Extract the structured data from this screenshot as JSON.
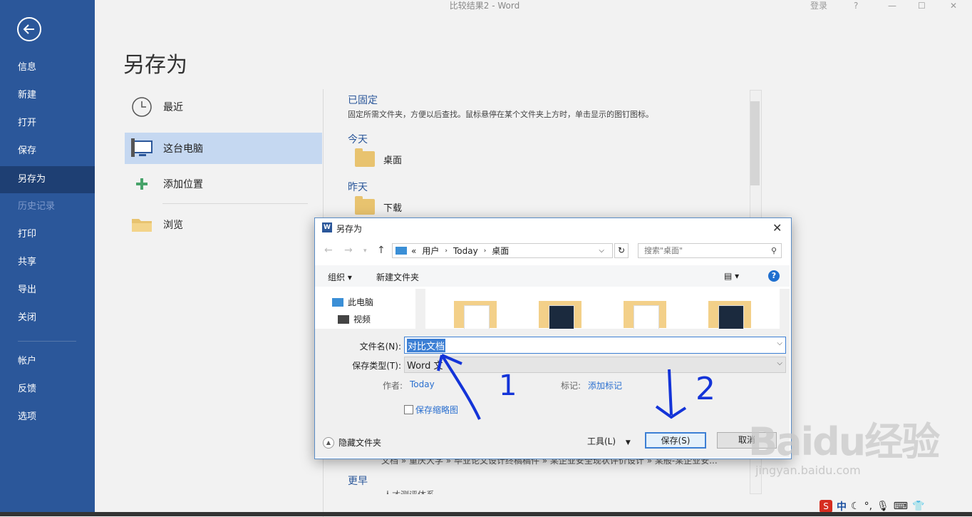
{
  "window": {
    "title": "比较结果2  -  Word",
    "login": "登录",
    "help": "?",
    "minimize": "—",
    "restore": "☐",
    "close": "✕"
  },
  "sidebar": {
    "items": [
      {
        "label": "信息"
      },
      {
        "label": "新建"
      },
      {
        "label": "打开"
      },
      {
        "label": "保存"
      },
      {
        "label": "另存为"
      },
      {
        "label": "历史记录"
      },
      {
        "label": "打印"
      },
      {
        "label": "共享"
      },
      {
        "label": "导出"
      },
      {
        "label": "关闭"
      },
      {
        "label": "帐户"
      },
      {
        "label": "反馈"
      },
      {
        "label": "选项"
      }
    ]
  },
  "page_title": "另存为",
  "places": [
    {
      "label": "最近",
      "icon": "clock-icon"
    },
    {
      "label": "这台电脑",
      "icon": "computer-icon"
    },
    {
      "label": "添加位置",
      "icon": "plus-icon"
    },
    {
      "label": "浏览",
      "icon": "folder-icon"
    }
  ],
  "recent": {
    "pinned_title": "已固定",
    "pinned_desc": "固定所需文件夹，方便以后查找。鼠标悬停在某个文件夹上方时，单击显示的图钉图标。",
    "today_title": "今天",
    "today_item": "桌面",
    "yesterday_title": "昨天",
    "yesterday_item": "下载",
    "behind_path": "文档 » 重庆大学 » 毕业论文设计终稿稿件 » 某企业安全现状评价设计 » 某般-某企业安...",
    "earlier_title": "更早",
    "earlier_item": "人才测评体系"
  },
  "dialog": {
    "title": "另存为",
    "address": {
      "sep": "«",
      "parts": [
        "用户",
        "Today",
        "桌面"
      ]
    },
    "search_placeholder": "搜索\"桌面\"",
    "organize": "组织 ▾",
    "new_folder": "新建文件夹",
    "tree": [
      {
        "label": "此电脑"
      },
      {
        "label": "视频"
      }
    ],
    "filename_label": "文件名(N):",
    "filename_value": "对比文档",
    "filetype_label": "保存类型(T):",
    "filetype_value": "Word 文",
    "author_label": "作者:",
    "author_value": "Today",
    "tags_label": "标记:",
    "tags_value": "添加标记",
    "thumbnail_label": "保存缩略图",
    "hide_folders": "隐藏文件夹",
    "tools": "工具(L)",
    "save": "保存(S)",
    "cancel": "取消"
  },
  "annotations": {
    "one": "1",
    "two": "2"
  },
  "watermark": {
    "logo": "Baidu经验",
    "url": "jingyan.baidu.com"
  },
  "taskbar": {
    "ime": "中"
  }
}
